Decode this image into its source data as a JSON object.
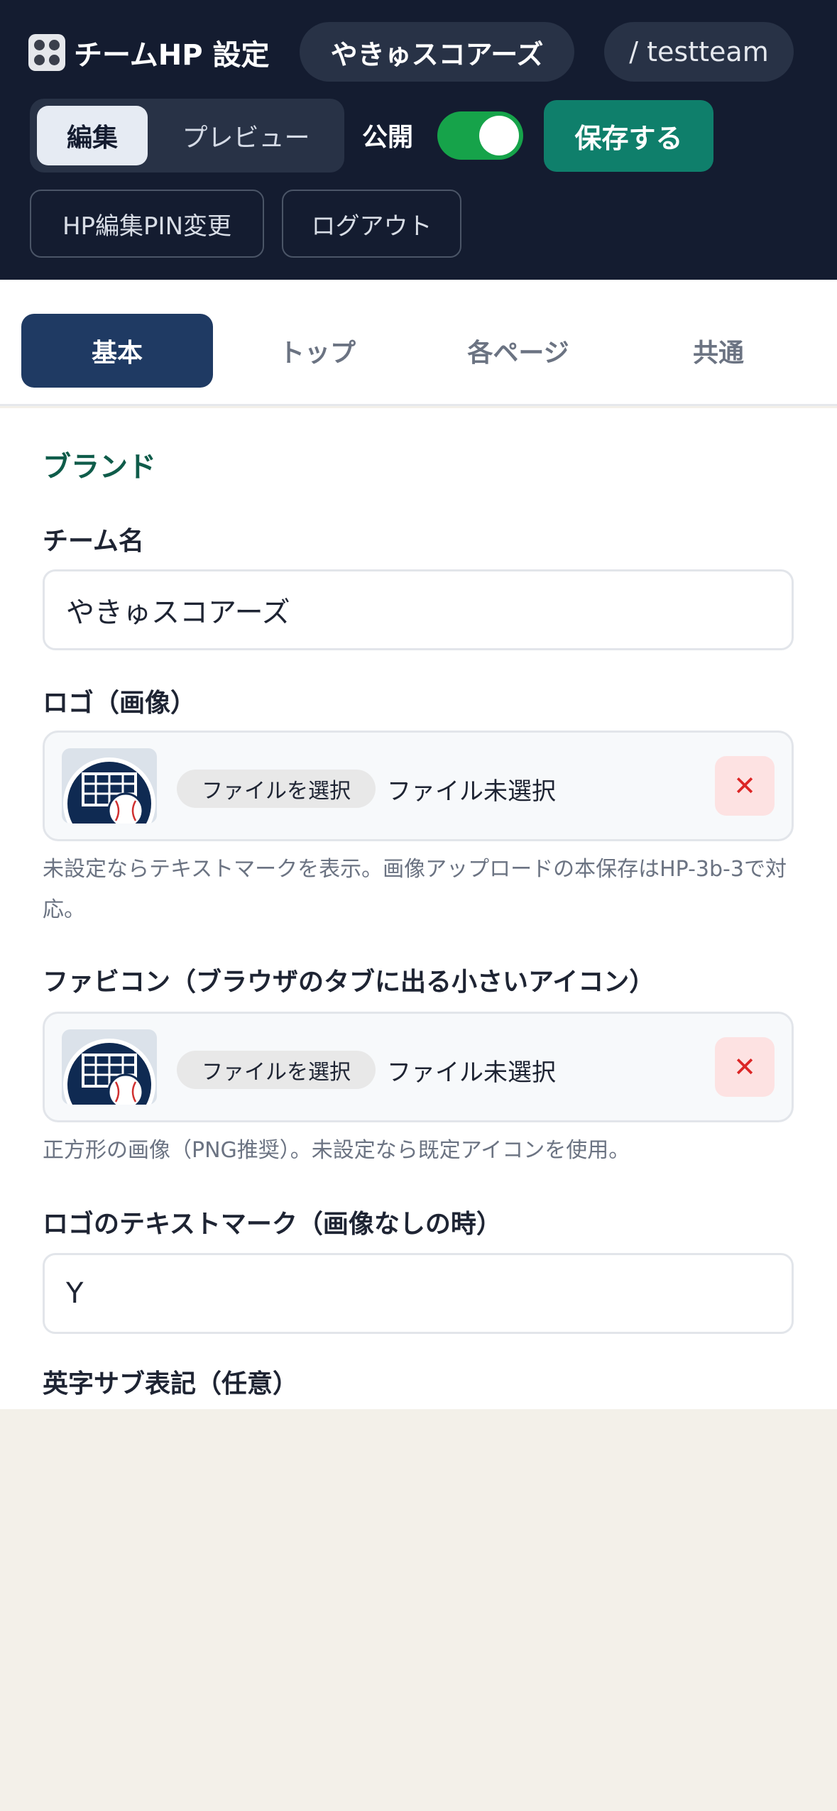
{
  "header": {
    "title": "チームHP 設定",
    "title_icon": "grid-icon",
    "team_name": "やきゅスコアーズ",
    "slug": "/ testteam",
    "mode_tabs": {
      "edit": "編集",
      "preview": "プレビュー"
    },
    "public_label": "公開",
    "public_on": true,
    "save_label": "保存する",
    "pin_change_label": "HP編集PIN変更",
    "logout_label": "ログアウト"
  },
  "tabs": [
    "基本",
    "トップ",
    "各ページ",
    "共通"
  ],
  "active_tab": "基本",
  "form": {
    "section_title": "ブランド",
    "team_name_label": "チーム名",
    "team_name_value": "やきゅスコアーズ",
    "logo_label": "ロゴ（画像）",
    "logo_choose": "ファイルを選択",
    "logo_status": "ファイル未選択",
    "logo_help": "未設定ならテキストマークを表示。画像アップロードの本保存はHP-3b-3で対応。",
    "favicon_label": "ファビコン（ブラウザのタブに出る小さいアイコン）",
    "favicon_choose": "ファイルを選択",
    "favicon_status": "ファイル未選択",
    "favicon_help": "正方形の画像（PNG推奨）。未設定なら既定アイコンを使用。",
    "textmark_label": "ロゴのテキストマーク（画像なしの時）",
    "textmark_value": "Y",
    "english_sub_label": "英字サブ表記（任意）",
    "remove_icon": "close-icon"
  },
  "colors": {
    "header_bg": "#141c30",
    "active_tab": "#1f3a63",
    "save_button": "#0f7f6b",
    "toggle_on": "#16a34a",
    "section_title": "#0f5c4a",
    "remove_bg": "#fde2e2",
    "remove_fg": "#dc2626",
    "page_bg": "#f3f0e9"
  }
}
